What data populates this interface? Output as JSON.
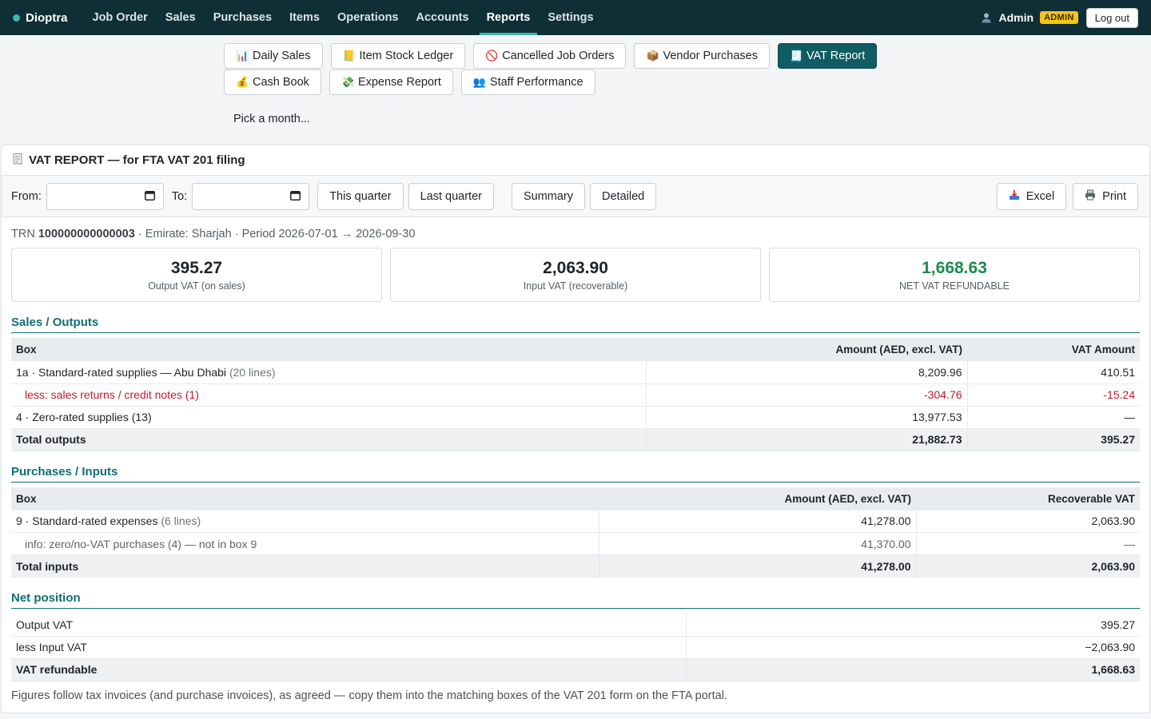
{
  "app": {
    "brand": "Dioptra",
    "nav": [
      "Job Order",
      "Sales",
      "Purchases",
      "Items",
      "Operations",
      "Accounts",
      "Reports",
      "Settings"
    ],
    "active_nav": "Reports",
    "user": "Admin",
    "role_badge": "ADMIN",
    "logout_label": "Log out"
  },
  "reports": {
    "row1": [
      {
        "icon": "📊",
        "label": "Daily Sales"
      },
      {
        "icon": "📒",
        "label": "Item Stock Ledger"
      },
      {
        "icon": "🚫",
        "label": "Cancelled Job Orders"
      },
      {
        "icon": "📦",
        "label": "Vendor Purchases"
      },
      {
        "icon": "🧾",
        "label": "VAT Report"
      }
    ],
    "row2": [
      {
        "icon": "💰",
        "label": "Cash Book"
      },
      {
        "icon": "💸",
        "label": "Expense Report"
      },
      {
        "icon": "👥",
        "label": "Staff Performance"
      }
    ],
    "active": "VAT Report",
    "month_picker": "Pick a month..."
  },
  "panel": {
    "title": "VAT REPORT — for FTA VAT 201 filing",
    "toolbar": {
      "from_label": "From:",
      "to_label": "To:",
      "this_quarter": "This quarter",
      "last_quarter": "Last quarter",
      "summary": "Summary",
      "detailed": "Detailed",
      "excel": "Excel",
      "print": "Print"
    },
    "meta": {
      "trn_label": "TRN",
      "trn": "100000000000003",
      "rest": " · Emirate: Sharjah · Period 2026-07-01 → 2026-09-30"
    },
    "cards": [
      {
        "value": "395.27",
        "label": "Output VAT (on sales)",
        "accent": "#1f2328"
      },
      {
        "value": "2,063.90",
        "label": "Input VAT (recoverable)",
        "accent": "#1f2328"
      },
      {
        "value": "1,668.63",
        "label": "NET VAT REFUNDABLE",
        "accent": "#1e8a4c"
      }
    ],
    "sales": {
      "title": "Sales / Outputs",
      "headers": [
        "Box",
        "Amount (AED, excl. VAT)",
        "VAT Amount"
      ],
      "rows": [
        {
          "label": "1a · Standard-rated supplies — Abu Dhabi",
          "note": "(20 lines)",
          "amount": "8,209.96",
          "vat": "410.51",
          "kind": "normal"
        },
        {
          "label": "less: sales returns / credit notes (1)",
          "note": "",
          "amount": "-304.76",
          "vat": "-15.24",
          "kind": "negative"
        },
        {
          "label": "4 · Zero-rated supplies (13)",
          "note": "",
          "amount": "13,977.53",
          "vat": "—",
          "kind": "normal"
        }
      ],
      "total": {
        "label": "Total outputs",
        "amount": "21,882.73",
        "vat": "395.27"
      }
    },
    "purchases": {
      "title": "Purchases / Inputs",
      "headers": [
        "Box",
        "Amount (AED, excl. VAT)",
        "Recoverable VAT"
      ],
      "rows": [
        {
          "label": "9 · Standard-rated expenses",
          "note": "(6 lines)",
          "amount": "41,278.00",
          "vat": "2,063.90",
          "kind": "normal"
        },
        {
          "label": "info: zero/no-VAT purchases (4) — not in box 9",
          "note": "",
          "amount": "41,370.00",
          "vat": "—",
          "kind": "info"
        }
      ],
      "total": {
        "label": "Total inputs",
        "amount": "41,278.00",
        "vat": "2,063.90"
      }
    },
    "net": {
      "title": "Net position",
      "rows": [
        {
          "label": "Output VAT",
          "value": "395.27"
        },
        {
          "label": "less Input VAT",
          "value": "−2,063.90"
        }
      ],
      "total": {
        "label": "VAT refundable",
        "value": "1,668.63"
      }
    },
    "footnote": "Figures follow tax invoices (and purchase invoices), as agreed — copy them into the matching boxes of the VAT 201 form on the FTA portal."
  }
}
